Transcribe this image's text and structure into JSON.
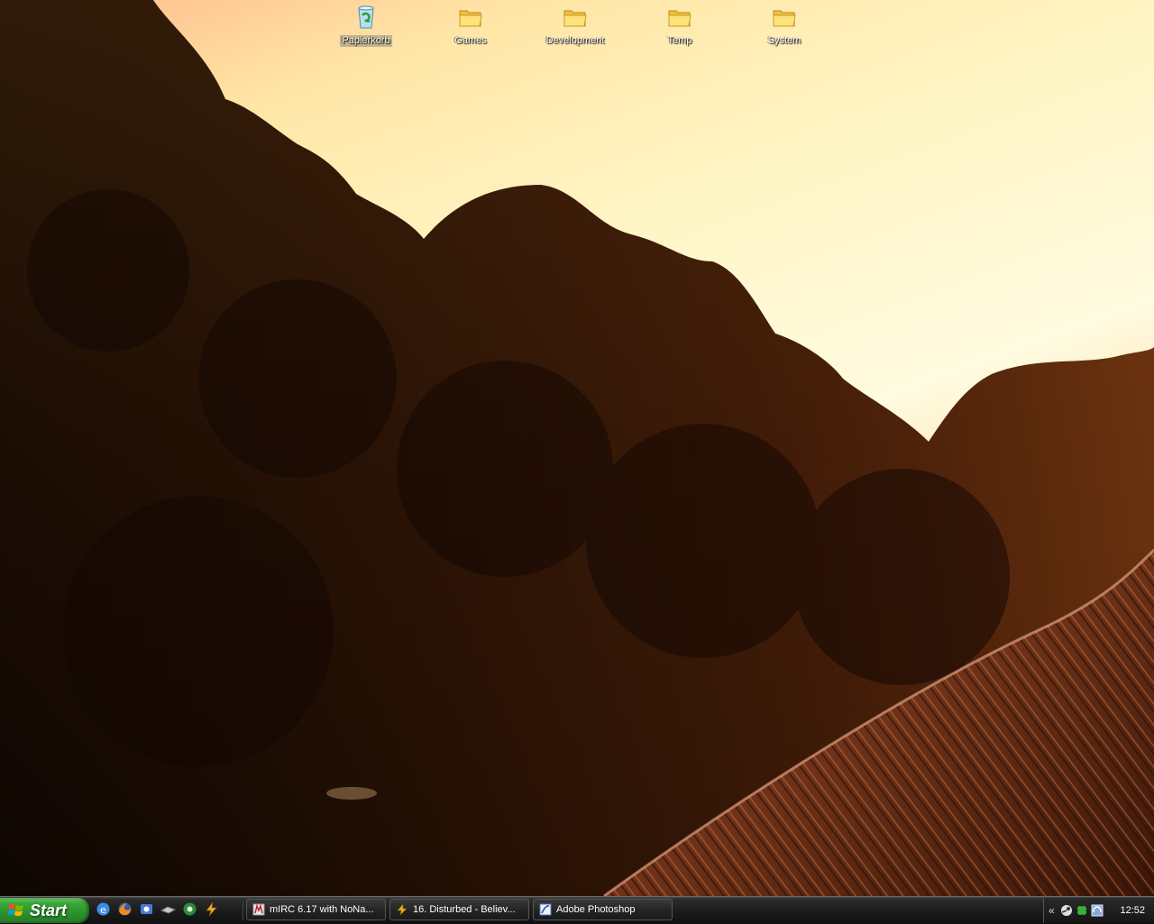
{
  "desktop": {
    "icons": [
      {
        "label": "Papierkorb",
        "icon": "recycle-bin-icon"
      },
      {
        "label": "Games",
        "icon": "folder-icon"
      },
      {
        "label": "Development",
        "icon": "folder-icon"
      },
      {
        "label": "Temp",
        "icon": "folder-icon"
      },
      {
        "label": "System",
        "icon": "folder-icon"
      }
    ]
  },
  "taskbar": {
    "start_label": "Start",
    "quick_launch": [
      "ie-icon",
      "firefox-icon",
      "outlook-icon",
      "show-desktop-icon",
      "media-icon",
      "winamp-icon"
    ],
    "tasks": [
      {
        "label": "mIRC 6.17 with NoNa...",
        "icon": "mirc-icon"
      },
      {
        "label": "16. Disturbed - Believ...",
        "icon": "winamp-icon"
      },
      {
        "label": "Adobe Photoshop",
        "icon": "photoshop-icon"
      }
    ],
    "tray": {
      "expand_label": "«",
      "icons": [
        "steam-icon",
        "clover-icon",
        "headphones-icon"
      ],
      "clock": "12:52"
    }
  },
  "colors": {
    "start_green": "#3aa83a",
    "taskbar_black": "#1c1c1c",
    "sky_light": "#fffbe0",
    "sunset_orange": "#d4822e"
  }
}
